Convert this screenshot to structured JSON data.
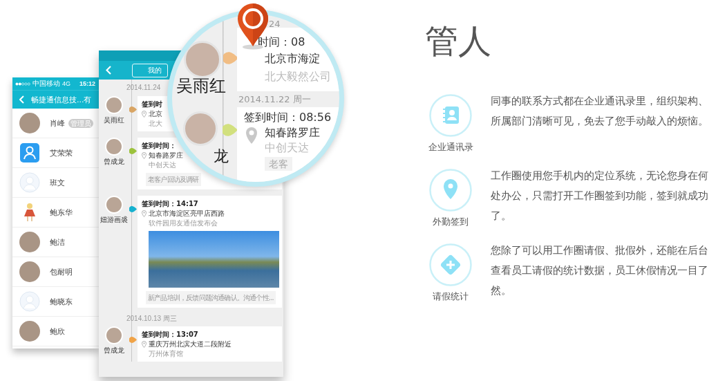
{
  "contacts_phone": {
    "status_bar": {
      "carrier": "中国移动",
      "network": "4G",
      "time": "15:12"
    },
    "title": "畅捷通信息技...有",
    "contacts": [
      {
        "name": "肖峰",
        "kind": "photo",
        "badge": "管理员"
      },
      {
        "name": "艾荣荣",
        "kind": "app"
      },
      {
        "name": "班文",
        "kind": "default"
      },
      {
        "name": "鲍东华",
        "kind": "figure"
      },
      {
        "name": "鲍洁",
        "kind": "photo"
      },
      {
        "name": "包耐明",
        "kind": "photo"
      },
      {
        "name": "鲍晓东",
        "kind": "default"
      },
      {
        "name": "鲍欣",
        "kind": "photo"
      }
    ]
  },
  "timeline_phone": {
    "header_button": "我的",
    "items": [
      {
        "kind": "date",
        "text": "2014.11.24"
      },
      {
        "kind": "checkin",
        "name": "吴雨红",
        "color": "#d9a564",
        "time": "签到时",
        "address": "北京",
        "place": "北大"
      },
      {
        "kind": "checkin",
        "name": "曾成龙",
        "color": "#9cc23d",
        "time": "签到时间：",
        "address": "知春路罗庄",
        "place": "中创天达",
        "note": "老客户回访及调研"
      },
      {
        "kind": "checkin",
        "name": "妞游画裘",
        "color": "#16b1cf",
        "time": "签到时间：14:17",
        "address": "北京市海淀区亮甲店西路",
        "place": "软件园用友通信发布会",
        "photo": true,
        "note": "新产品培训，反馈问题沟通确认。沟通个性..."
      },
      {
        "kind": "date",
        "text": "2014.10.13  周三"
      },
      {
        "kind": "checkin",
        "name": "曾成龙",
        "color": "#f0a347",
        "time": "签到时间：13:07",
        "address": "重庆万州北滨大道二段附近",
        "place": "万州体育馆"
      }
    ]
  },
  "magnifier": {
    "date_fragment": "24",
    "items": [
      {
        "kind": "checkin",
        "name": "吴雨红",
        "color": "#f1bd84",
        "time": "时间：08",
        "address": "北京市海淀",
        "place": "北大毅然公司"
      },
      {
        "kind": "date",
        "text": "2014.11.22  周一"
      },
      {
        "kind": "checkin",
        "name": "龙",
        "color": "#d2e07e",
        "time": "签到时间：08:56",
        "address": "知春路罗庄",
        "place": "中创天达",
        "note": "老客"
      }
    ]
  },
  "feature_section": {
    "title": "管人",
    "features": [
      {
        "kind": "contacts",
        "label": "企业通讯录",
        "text": "同事的联系方式都在企业通讯录里，组织架构、所属部门清晰可见，免去了您手动敲入的烦恼。"
      },
      {
        "kind": "location",
        "label": "外勤签到",
        "text": "工作圈使用您手机内的定位系统，无论您身在何处办公，只需打开工作圈签到功能，签到就成功了。"
      },
      {
        "kind": "leave",
        "label": "请假统计",
        "text": "您除了可以用工作圈请假、批假外，还能在后台查看员工请假的统计数据，员工休假情况一目了然。"
      }
    ]
  }
}
